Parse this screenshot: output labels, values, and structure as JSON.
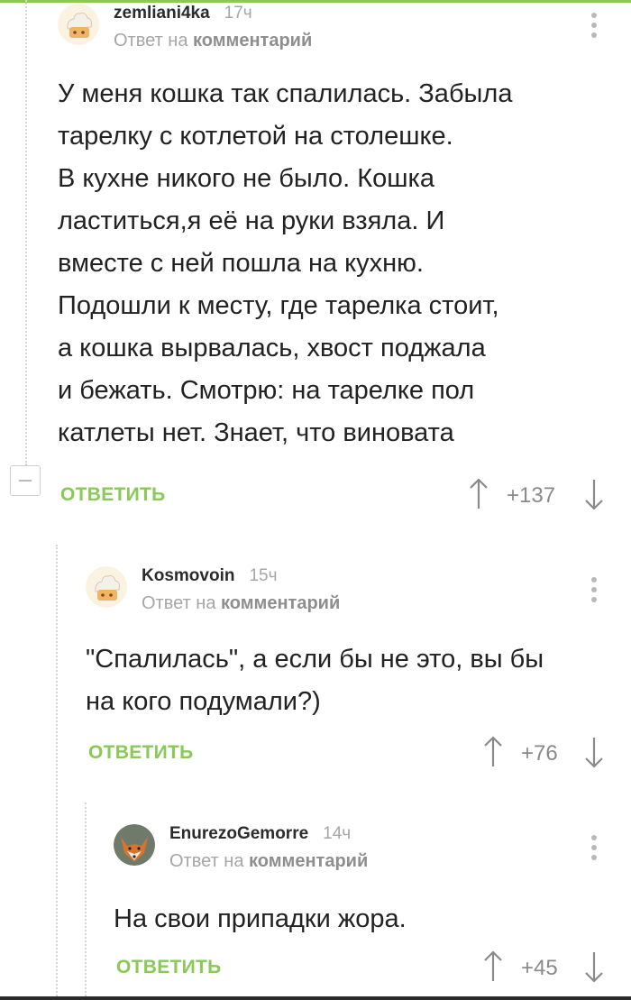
{
  "colors": {
    "accent_green": "#8ac858",
    "muted_text": "#a6a6a6",
    "body_text": "#222222",
    "icon_gray": "#b9b9b9"
  },
  "comments": [
    {
      "username": "zemliani4ka",
      "time": "17ч",
      "reply_prefix": "Ответ на",
      "reply_target": "комментарий",
      "body_lines": [
        "У меня кошка так спалилась. Забыла",
        "тарелку с котлетой на столешке.",
        "В кухне никого не было. Кошка",
        "ластиться,я её на руки взяла. И",
        "вместе с ней пошла на кухню.",
        "Подошли к месту, где тарелка стоит,",
        "а кошка вырвалась, хвост поджала",
        "и бежать. Смотрю: на тарелке пол",
        "катлеты нет. Знает, что виновата"
      ],
      "reply_label": "ОТВЕТИТЬ",
      "score": "+137",
      "avatar_icon": "chef-hat-avatar-icon"
    },
    {
      "username": "Kosmovoin",
      "time": "15ч",
      "reply_prefix": "Ответ на",
      "reply_target": "комментарий",
      "body_lines": [
        "\"Спалилась\", а если бы не это, вы бы",
        "на кого подумали?)"
      ],
      "reply_label": "ОТВЕТИТЬ",
      "score": "+76",
      "avatar_icon": "chef-hat-avatar-icon"
    },
    {
      "username": "EnurezoGemorre",
      "time": "14ч",
      "reply_prefix": "Ответ на",
      "reply_target": "комментарий",
      "body_lines": [
        "На свои припадки жора."
      ],
      "reply_label": "ОТВЕТИТЬ",
      "score": "+45",
      "avatar_icon": "fox-avatar-icon"
    }
  ]
}
